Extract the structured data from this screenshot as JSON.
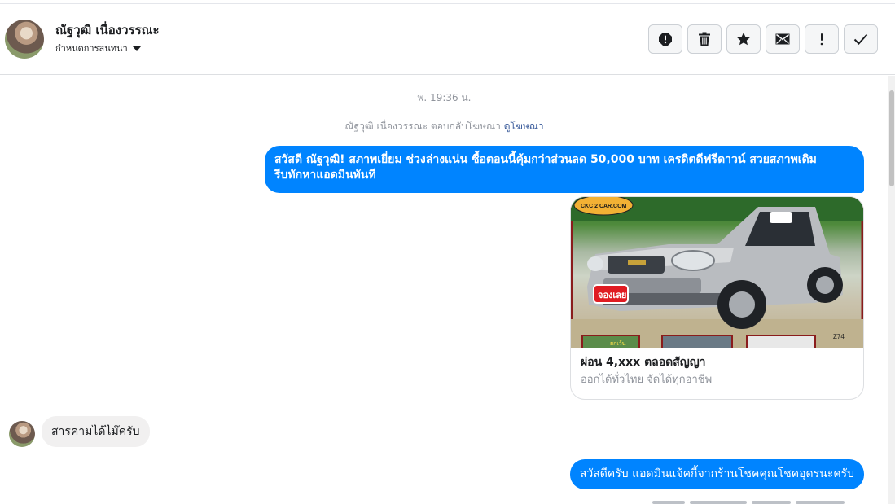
{
  "header": {
    "contact_name": "ณัฐวุฒิ เนื่องวรรณะ",
    "subtitle": "กำหนดการสนทนา",
    "actions": [
      {
        "name": "spam-button",
        "icon": "alert-circle-icon"
      },
      {
        "name": "delete-button",
        "icon": "trash-icon"
      },
      {
        "name": "star-button",
        "icon": "star-icon"
      },
      {
        "name": "mark-unread-button",
        "icon": "envelope-icon"
      },
      {
        "name": "important-button",
        "icon": "exclamation-icon"
      },
      {
        "name": "mark-done-button",
        "icon": "checkmark-icon"
      }
    ]
  },
  "thread": {
    "timestamp": "พ. 19:36 น.",
    "reply_prefix": "ณัฐวุฒิ เนื่องวรรณะ ตอบกลับโฆษณา",
    "reply_link": "ดูโฆษณา",
    "message_1": {
      "line1_a": "สวัสดี ณัฐวุฒิ!  สภาพเยี่ยม ช่วงล่างแน่น  ซื้อตอนนี้คุ้มกว่าส่วนลด ",
      "line1_price": "50,000 บาท",
      "line1_b": " เครดิตดีฟรีดาวน์  สวยสภาพเดิม",
      "line2": "รีบทักหาแอดมินทันที"
    },
    "ad_card": {
      "image_logo": "CKC 2 CAR.COM",
      "image_badge": "จองเลย",
      "image_code": "Z74",
      "image_sub_tag": "ยกเว้น",
      "title": "ผ่อน 4,xxx ตลอดสัญญา",
      "subtitle": "ออกได้ทั่วไทย จัดได้ทุกอาชีพ"
    },
    "incoming_message": "สารคามได้ไม๊ครับ",
    "message_2": "สวัสดีครับ แอดมินแจ้คกี้จากร้านโชคคุณโชคอุดรนะครับ"
  },
  "colors": {
    "outgoing_bubble": "#0084ff",
    "incoming_bubble": "#f1f0f0",
    "link": "#365899",
    "meta_text": "#90949c"
  }
}
